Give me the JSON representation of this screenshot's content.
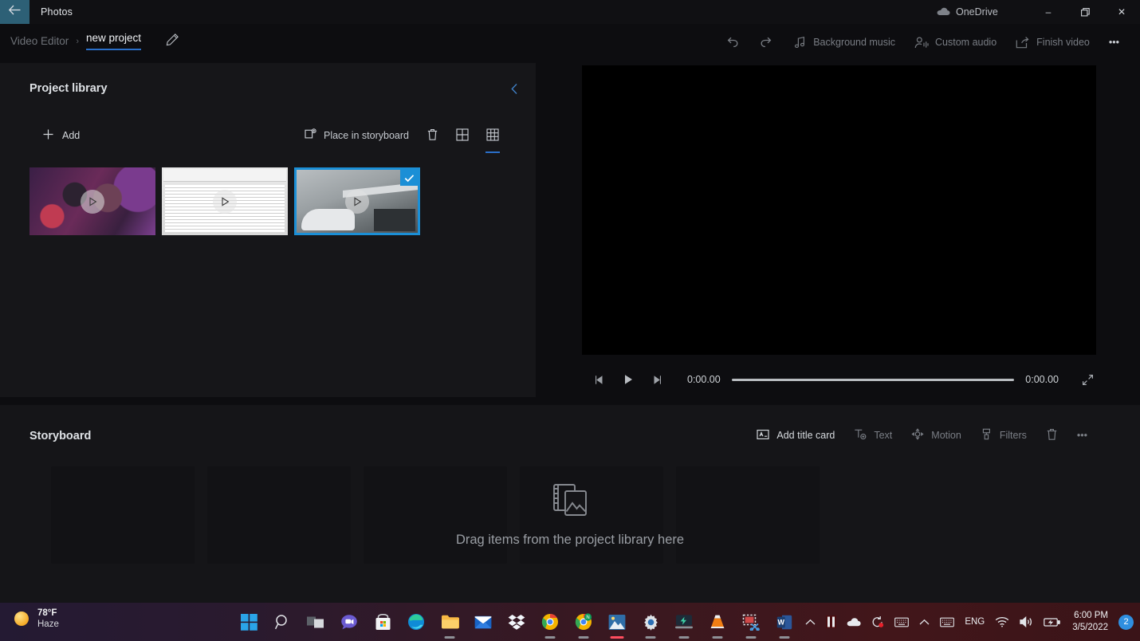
{
  "titlebar": {
    "back_icon": "back-arrow-icon",
    "app_name": "Photos",
    "onedrive_label": "OneDrive",
    "onedrive_icon": "cloud-icon",
    "minimize": "–",
    "maximize": "❐",
    "close": "✕"
  },
  "commandbar": {
    "breadcrumb_root": "Video Editor",
    "breadcrumb_sep": "›",
    "breadcrumb_current": "new project",
    "rename_icon": "pencil-icon",
    "undo_icon": "undo-icon",
    "redo_icon": "redo-icon",
    "items": [
      {
        "label": "Background music",
        "icon": "music-note-icon",
        "enabled": false
      },
      {
        "label": "Custom audio",
        "icon": "person-audio-icon",
        "enabled": false
      },
      {
        "label": "Finish video",
        "icon": "export-video-icon",
        "enabled": false
      }
    ],
    "overflow_label": "•••"
  },
  "library": {
    "title": "Project library",
    "collapse_icon": "chevron-left-icon",
    "add_label": "Add",
    "add_icon": "plus-icon",
    "tools": [
      {
        "label": "Place in storyboard",
        "icon": "place-in-storyboard-icon",
        "active": false
      },
      {
        "label": "",
        "icon": "trash-icon",
        "active": false
      },
      {
        "label": "",
        "icon": "grid-large-icon",
        "active": false
      },
      {
        "label": "",
        "icon": "grid-small-icon",
        "active": true
      }
    ],
    "thumbnails": [
      {
        "name": "thumbnail-people-crowd",
        "art": "art1",
        "selected": false
      },
      {
        "name": "thumbnail-spreadsheet",
        "art": "art2",
        "selected": false
      },
      {
        "name": "thumbnail-garage-car",
        "art": "art3",
        "selected": true
      }
    ],
    "play_icon": "play-icon",
    "check_icon": "check-icon"
  },
  "preview": {
    "prev_frame_icon": "previous-frame-icon",
    "play_icon": "play-icon",
    "next_frame_icon": "next-frame-icon",
    "current_time": "0:00.00",
    "total_time": "0:00.00",
    "fullscreen_icon": "fullscreen-icon"
  },
  "storyboard": {
    "title": "Storyboard",
    "tools": [
      {
        "label": "Add title card",
        "icon": "title-card-icon",
        "enabled": true
      },
      {
        "label": "Text",
        "icon": "text-icon",
        "enabled": false
      },
      {
        "label": "Motion",
        "icon": "motion-icon",
        "enabled": false
      },
      {
        "label": "Filters",
        "icon": "filters-icon",
        "enabled": false
      },
      {
        "label": "",
        "icon": "trash-icon",
        "enabled": false
      },
      {
        "label": "•••",
        "icon": "overflow-icon",
        "enabled": false
      }
    ],
    "drop_hint": "Drag items from the project library here",
    "drop_icon": "media-placeholder-icon",
    "slot_count": 5
  },
  "taskbar": {
    "weather": {
      "temperature": "78°F",
      "condition": "Haze",
      "icon": "sun-icon"
    },
    "apps": [
      {
        "name": "start-button",
        "icon": "windows-logo-icon",
        "active": false
      },
      {
        "name": "search-button",
        "icon": "search-icon",
        "active": false
      },
      {
        "name": "task-view-button",
        "icon": "task-view-icon",
        "active": false
      },
      {
        "name": "chat-button",
        "icon": "chat-icon",
        "active": false
      },
      {
        "name": "store-button",
        "icon": "microsoft-store-icon",
        "active": false
      },
      {
        "name": "edge-button",
        "icon": "edge-icon",
        "active": false
      },
      {
        "name": "file-explorer-button",
        "icon": "folder-icon",
        "active": true
      },
      {
        "name": "mail-button",
        "icon": "mail-icon",
        "active": false
      },
      {
        "name": "dropbox-button",
        "icon": "dropbox-icon",
        "active": false
      },
      {
        "name": "chrome-button",
        "icon": "chrome-icon",
        "active": true
      },
      {
        "name": "chrome-second-button",
        "icon": "chrome-icon",
        "active": true
      },
      {
        "name": "photos-button",
        "icon": "photos-icon",
        "active": true
      },
      {
        "name": "settings-button",
        "icon": "gear-icon",
        "active": true
      },
      {
        "name": "driver-app-button",
        "icon": "driver-booster-icon",
        "active": true
      },
      {
        "name": "vlc-button",
        "icon": "vlc-cone-icon",
        "active": true
      },
      {
        "name": "snipping-tool-button",
        "icon": "snipping-tool-icon",
        "active": true
      },
      {
        "name": "word-button",
        "icon": "word-icon",
        "active": true
      }
    ],
    "tray": {
      "overflow_icon": "chevron-up-icon",
      "app_icon": "tray-app-icon",
      "onedrive_icon": "cloud-icon",
      "sync_icon": "sync-alert-icon",
      "ime_icon": "keyboard-icon",
      "language": "ENG",
      "wifi_icon": "wifi-icon",
      "volume_icon": "speaker-icon",
      "battery_icon": "battery-charging-icon",
      "time": "6:00 PM",
      "date": "3/5/2022",
      "notification_count": "2"
    }
  },
  "colors": {
    "accent_blue": "#2a6fc9",
    "selection_blue": "#1b8fd6",
    "panel_bg": "#161619",
    "storyboard_bg": "#151518",
    "back_btn_bg": "#2d6076"
  }
}
